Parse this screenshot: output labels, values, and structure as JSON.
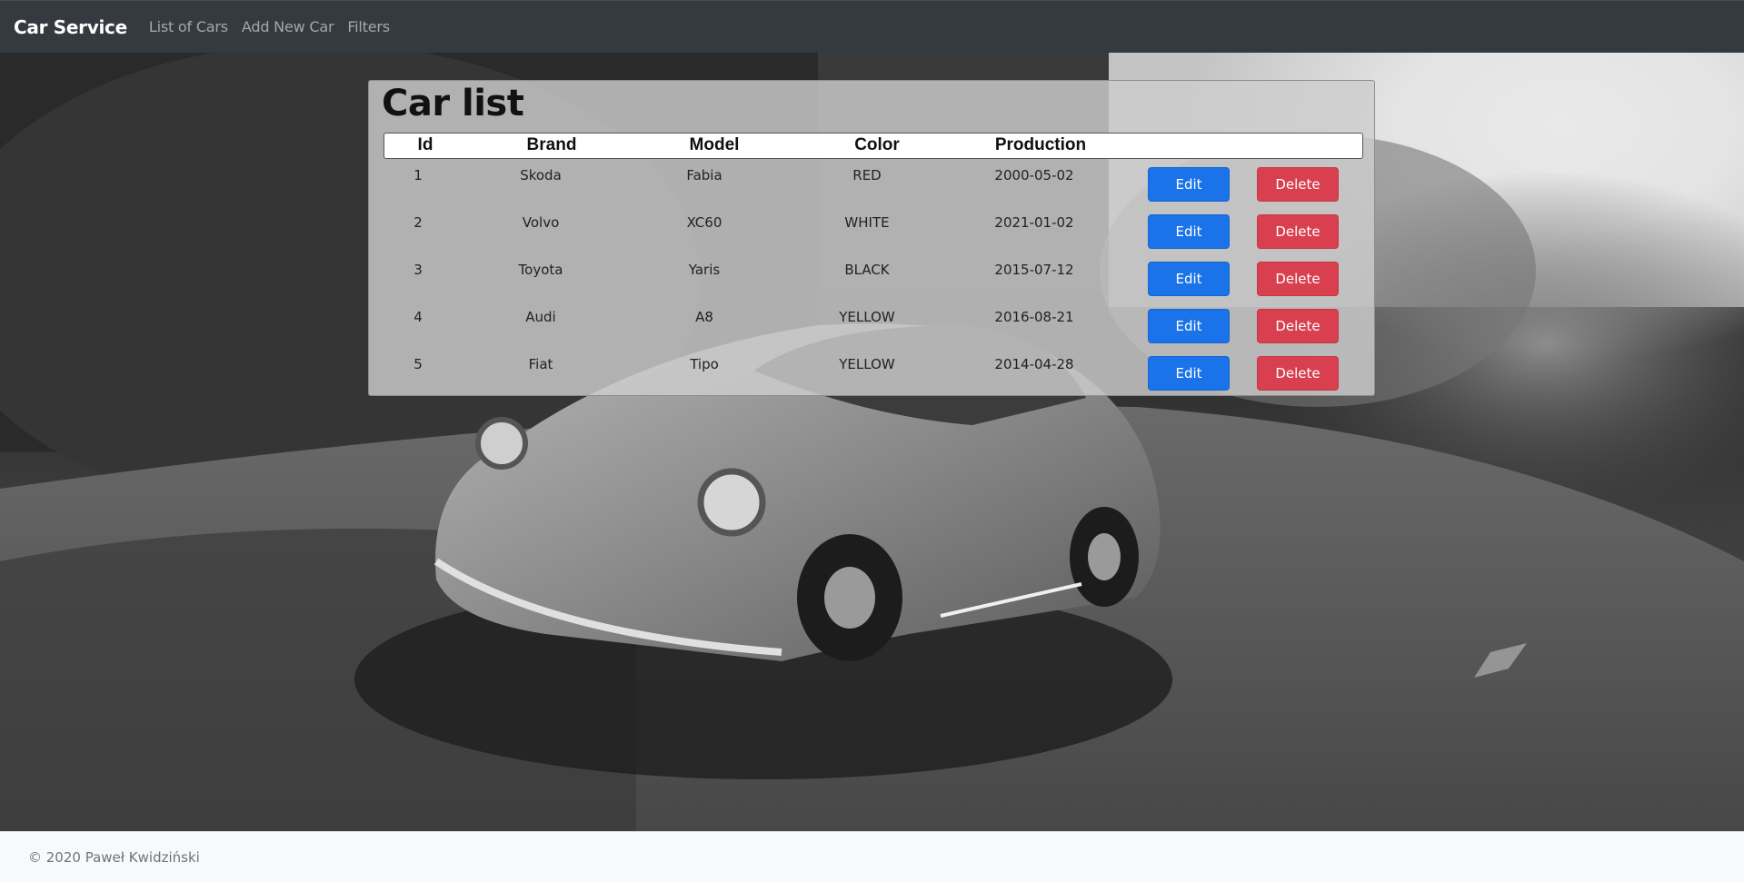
{
  "navbar": {
    "brand": "Car Service",
    "links": [
      "List of Cars",
      "Add New Car",
      "Filters"
    ]
  },
  "panel": {
    "title": "Car list",
    "columns": [
      "Id",
      "Brand",
      "Model",
      "Color",
      "Production"
    ],
    "rows": [
      {
        "id": "1",
        "brand": "Skoda",
        "model": "Fabia",
        "color": "RED",
        "production": "2000-05-02"
      },
      {
        "id": "2",
        "brand": "Volvo",
        "model": "XC60",
        "color": "WHITE",
        "production": "2021-01-02"
      },
      {
        "id": "3",
        "brand": "Toyota",
        "model": "Yaris",
        "color": "BLACK",
        "production": "2015-07-12"
      },
      {
        "id": "4",
        "brand": "Audi",
        "model": "A8",
        "color": "YELLOW",
        "production": "2016-08-21"
      },
      {
        "id": "5",
        "brand": "Fiat",
        "model": "Tipo",
        "color": "YELLOW",
        "production": "2014-04-28"
      }
    ],
    "edit_label": "Edit",
    "delete_label": "Delete"
  },
  "footer": {
    "text": "© 2020 Paweł Kwidziński"
  },
  "colors": {
    "navbar_bg": "#343a40",
    "edit_button": "#1a73e8",
    "delete_button": "#d9404f",
    "footer_bg": "#f8f9fa"
  }
}
